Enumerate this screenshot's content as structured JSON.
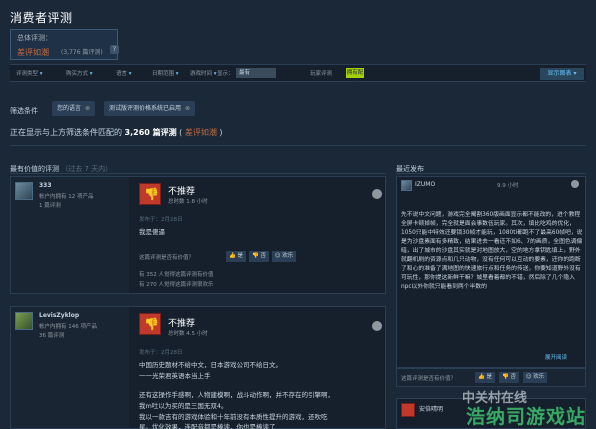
{
  "header": {
    "title": "消费者评测"
  },
  "summary": {
    "label": "总体评测：",
    "score": "差评如潮",
    "count": "(3,776 篇评测)",
    "help": "?"
  },
  "filters": {
    "items": [
      "评测类型",
      "购买方式",
      "语言",
      "日期范围",
      "游戏时间",
      "显示：",
      "玩家评测"
    ],
    "display_value": "最有",
    "mode_label": "拥有配置",
    "show_graph": "显示图表"
  },
  "active_filters": {
    "label": "筛选条件",
    "chips": [
      "您的语言",
      "测试版评测价格系统已启用"
    ]
  },
  "showing": {
    "prefix": "正在显示与上方筛选条件匹配的",
    "count": "3,260 篇评测",
    "open": " ( ",
    "verdict": "差评如潮",
    "close": " )"
  },
  "sections": {
    "most_helpful": "最有价值的评测",
    "most_helpful_sub": "（过去 7 天内）",
    "recent": "最近发布"
  },
  "reviews": [
    {
      "user": "333",
      "meta1": "帐户内拥有 12 项产品",
      "meta2": "1 篇评测",
      "verdict": "不推荐",
      "hours": "总时数 1.8 小时",
      "posted": "发布于：2月28日",
      "body": [
        "我是傻逼"
      ],
      "helpful_q": "这篇评测是否有价值？",
      "btn_yes": "是",
      "btn_no": "否",
      "btn_funny": "欢乐",
      "stat1": "有 352 人觉得这篇评测有价值",
      "stat2": "有 270 人觉得这篇评测很欢乐"
    },
    {
      "user": "LevisZyklop",
      "meta1": "帐户内拥有 146 项产品",
      "meta2": "36 篇评测",
      "verdict": "不推荐",
      "hours": "总时数 4.5 小时",
      "posted": "发布于：2月28日",
      "body": [
        "中国历史题材不给中文，日本游戏公司不给日文。",
        "一一光荣君英语本当上手",
        "",
        "还有这操作手感啊，人物建模啊，战斗动作啊，并不存在的引擎啊，",
        "我m吐以为买的是三国无双4。",
        "我以一款吉有的游戏体验和十年前没有本质性提升的游戏，还吹吃",
        "星。优化效果，连配音都是棒读，你也是棒读了"
      ]
    }
  ],
  "recent": {
    "user": "IZUMO",
    "hours": "9.9 小时",
    "text": "先不说中文问题，游戏完全阉割360版画面显示都不能改的，进个教程全屏卡顿掉帧，完全就是面会事数伍玩家。其次，填比吃鸡的优化，1050只能中特效还要锁30帧才能玩，1080ti都跑不了最高60帧吧，说是为沙盘素面有多精致，结果进去一看还不如6、7的画质，全图色调偏暗，出了城市的沙盘其实就是对地图放大，空的地方拿钥匙填上，野外就翻机刷的资源点和几只动物，没有任何可以互动的要素，还你的跑断了和心的准备了满地图的快速旅行点和任务的传送，你要知道野外没有可玩性，那你提这新鲜干嘛？城里看着都的不错，然后除了几个隐入npc以外你就只能看到两个半数的",
    "more": "展开阅读",
    "helpful": "这篇评测是否有价值？",
    "yes": "是",
    "no": "否",
    "funny": "欢乐",
    "card3_user": "安倍晴明"
  },
  "watermark": {
    "line1": "中关村在线",
    "line2": "浩纳司游戏站"
  }
}
